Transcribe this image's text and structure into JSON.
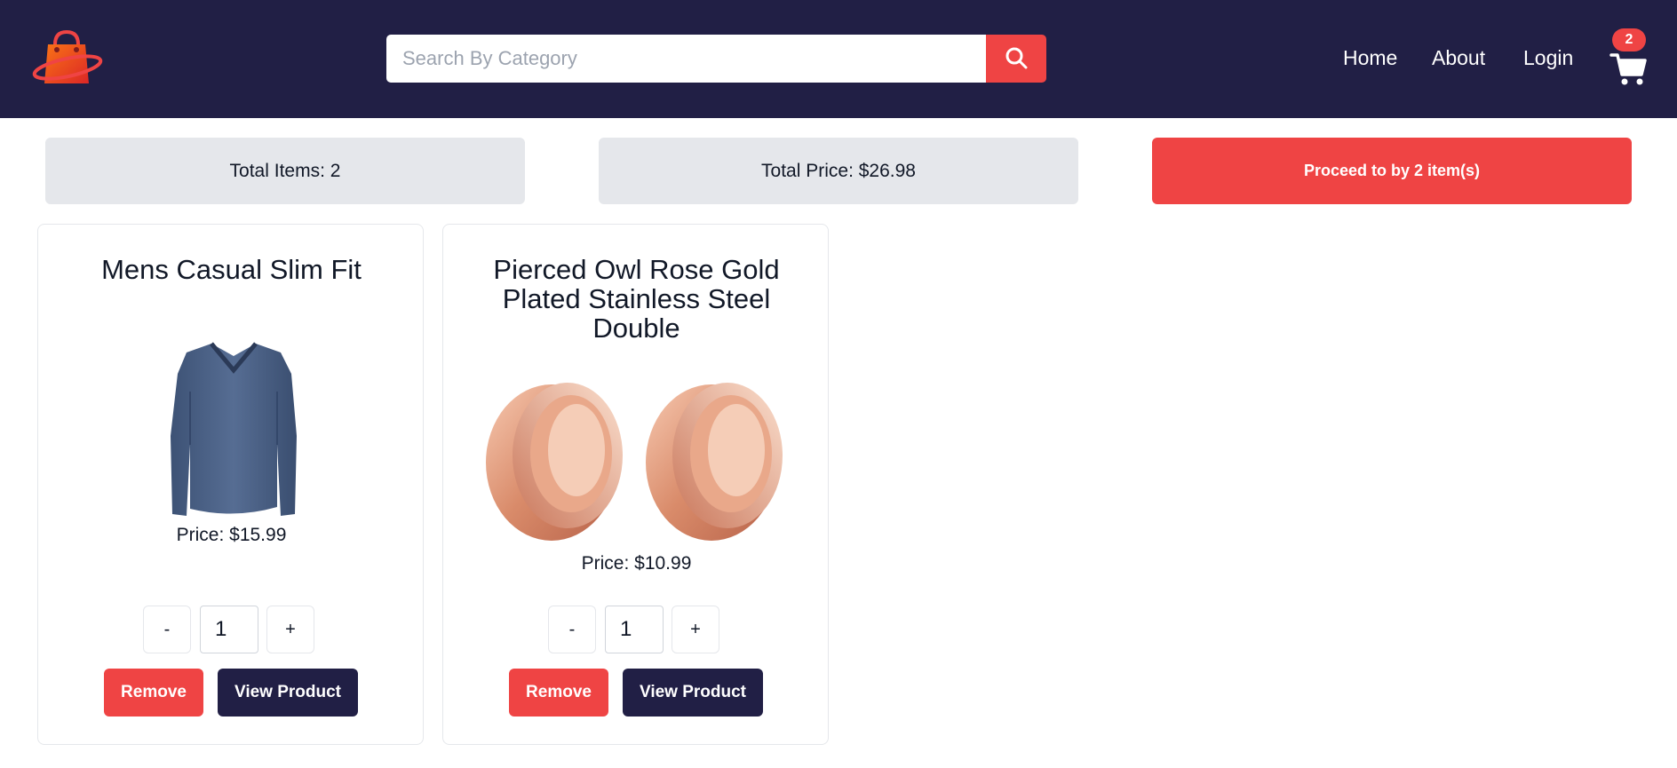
{
  "header": {
    "search": {
      "placeholder": "Search By Category"
    },
    "nav": [
      {
        "label": "Home"
      },
      {
        "label": "About"
      },
      {
        "label": "Login"
      }
    ],
    "cart_count": "2",
    "colors": {
      "navbar": "#211f45",
      "accent": "#ef4444"
    }
  },
  "summary": {
    "total_items": "Total Items: 2",
    "total_price": "Total Price: $26.98",
    "proceed_label": "Proceed to by 2 item(s)"
  },
  "products": [
    {
      "title": "Mens Casual Slim Fit",
      "image_icon": "shirt-image",
      "price": "Price: $15.99",
      "minus": "-",
      "quantity": "1",
      "plus": "+",
      "remove_label": "Remove",
      "view_label": "View Product"
    },
    {
      "title": "Pierced Owl Rose Gold Plated Stainless Steel Double",
      "image_icon": "earrings-image",
      "price": "Price: $10.99",
      "minus": "-",
      "quantity": "1",
      "plus": "+",
      "remove_label": "Remove",
      "view_label": "View Product"
    }
  ]
}
